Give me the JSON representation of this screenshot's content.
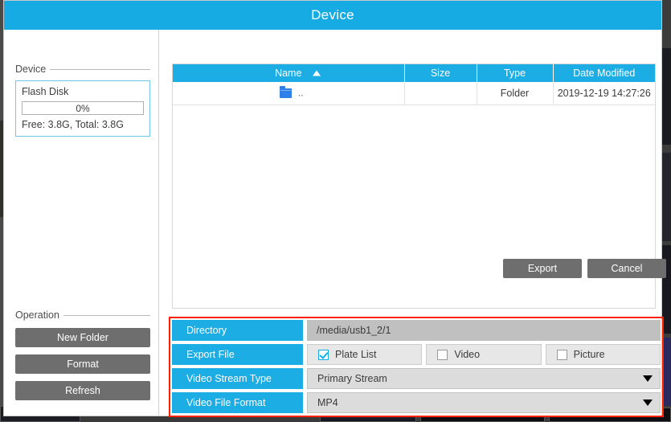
{
  "window": {
    "title": "Device"
  },
  "sidebar": {
    "device_group": {
      "title": "Device",
      "name": "Flash Disk",
      "usage_percent_label": "0%",
      "usage_percent_value": 0,
      "capacity": "Free: 3.8G, Total: 3.8G"
    },
    "operation_group": {
      "title": "Operation",
      "buttons": [
        {
          "label": "New Folder",
          "name": "new-folder-button"
        },
        {
          "label": "Format",
          "name": "format-button"
        },
        {
          "label": "Refresh",
          "name": "refresh-button"
        }
      ]
    }
  },
  "filelist": {
    "columns": [
      {
        "label": "Name",
        "sorted": "asc",
        "sort_icon": "triangle-up-icon"
      },
      {
        "label": "Size"
      },
      {
        "label": "Type"
      },
      {
        "label": "Date Modified"
      }
    ],
    "rows": [
      {
        "icon": "folder-icon",
        "name": "..",
        "size": "",
        "type": "Folder",
        "date_modified": "2019-12-19 14:27:26"
      }
    ]
  },
  "form": {
    "highlight_color": "#ff2000",
    "directory": {
      "label": "Directory",
      "value": "/media/usb1_2/1"
    },
    "export_file": {
      "label": "Export File",
      "options": [
        {
          "label": "Plate List",
          "checked": true
        },
        {
          "label": "Video",
          "checked": false
        },
        {
          "label": "Picture",
          "checked": false
        }
      ]
    },
    "video_stream_type": {
      "label": "Video Stream Type",
      "value": "Primary Stream",
      "icon": "chevron-down-icon"
    },
    "video_file_format": {
      "label": "Video File Format",
      "value": "MP4",
      "icon": "chevron-down-icon"
    }
  },
  "footer": {
    "export_label": "Export",
    "cancel_label": "Cancel"
  },
  "colors": {
    "accent": "#16ace3",
    "header": "#1cadE4",
    "button": "#6e6e6e",
    "highlight": "#ff2000",
    "folder": "#2f7fe8"
  }
}
